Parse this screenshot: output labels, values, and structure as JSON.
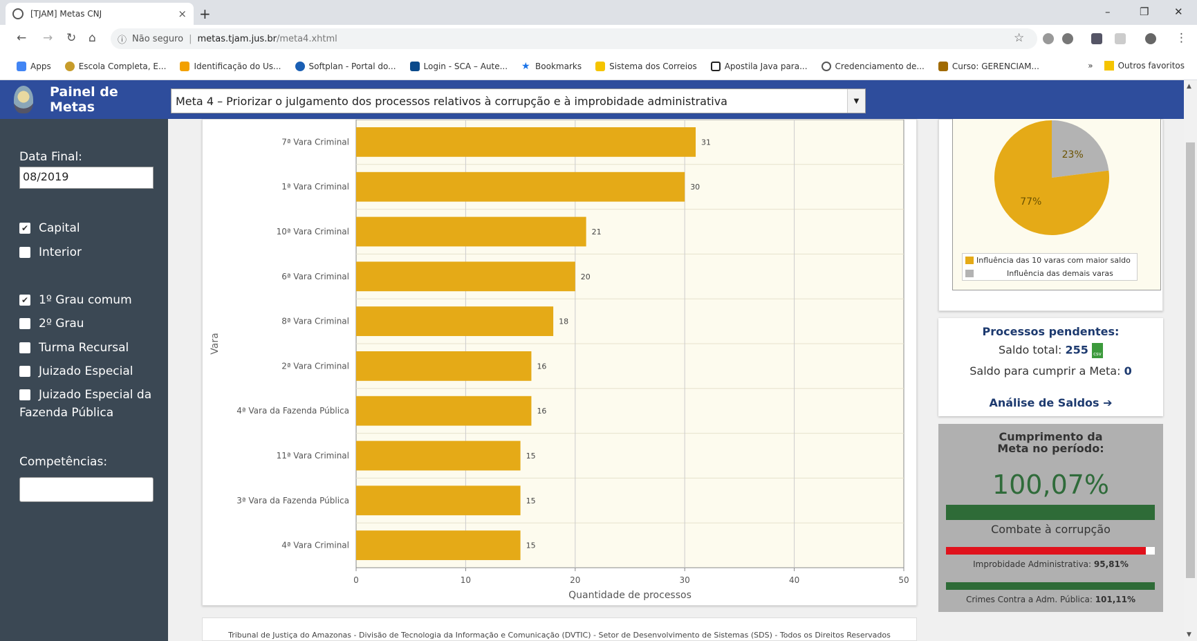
{
  "browser": {
    "tab_title": "[TJAM] Metas CNJ",
    "tab_close": "×",
    "new_tab": "+",
    "security_label": "Não seguro",
    "url_host": "metas.tjam.jus.br",
    "url_path": "/meta4.xhtml",
    "bookmarks": [
      "Apps",
      "Escola Completa, E...",
      "Identificação do Us...",
      "Softplan - Portal do...",
      "Login - SCA – Aute...",
      "Bookmarks",
      "Sistema dos Correios",
      "Apostila Java para...",
      "Credenciamento de...",
      "Curso: GERENCIAM..."
    ],
    "bookmarks_more": "»",
    "other_bookmarks": "Outros favoritos"
  },
  "header": {
    "title": "Painel de Metas",
    "selected_meta": "Meta 4 – Priorizar o julgamento dos processos relativos à corrupção e à improbidade administrativa"
  },
  "sidebar": {
    "date_label": "Data Final:",
    "date_value": "08/2019",
    "filters_location": [
      {
        "label": "Capital",
        "checked": true
      },
      {
        "label": "Interior",
        "checked": false
      }
    ],
    "filters_grau": [
      {
        "label": "1º Grau comum",
        "checked": true
      },
      {
        "label": "2º Grau",
        "checked": false
      },
      {
        "label": "Turma Recursal",
        "checked": false
      },
      {
        "label": "Juizado Especial",
        "checked": false
      },
      {
        "label": "Juizado Especial da Fazenda Pública",
        "checked": false
      }
    ],
    "competencias_label": "Competências:"
  },
  "chart_data": [
    {
      "type": "bar",
      "orientation": "horizontal",
      "categories": [
        "7ª Vara Criminal",
        "1ª Vara Criminal",
        "10ª Vara Criminal",
        "6ª Vara Criminal",
        "8ª Vara Criminal",
        "2ª Vara Criminal",
        "4ª Vara da Fazenda Pública",
        "11ª Vara Criminal",
        "3ª Vara da Fazenda Pública",
        "4ª Vara Criminal"
      ],
      "values": [
        31,
        30,
        21,
        20,
        18,
        16,
        16,
        15,
        15,
        15
      ],
      "xlabel": "Quantidade de processos",
      "ylabel": "Vara",
      "xlim": [
        0,
        50
      ],
      "xticks": [
        0,
        10,
        20,
        30,
        40,
        50
      ],
      "bar_color": "#e5aa17",
      "background": "#fdfbee",
      "grid": true
    },
    {
      "type": "pie",
      "slices": [
        {
          "label": "Influência das 10 varas com maior saldo",
          "value": 77,
          "text": "77%",
          "color": "#e5aa17"
        },
        {
          "label": "Influência das demais varas",
          "value": 23,
          "text": "23%",
          "color": "#b3b3b3"
        }
      ]
    }
  ],
  "pendentes": {
    "title": "Processos pendentes:",
    "saldo_total_label": "Saldo total:",
    "saldo_total_value": "255",
    "csv_icon_text": "csv",
    "saldo_meta_label": "Saldo para cumprir a Meta:",
    "saldo_meta_value": "0",
    "analise_link": "Análise de Saldos",
    "analise_arrow": "➔"
  },
  "cumprimento": {
    "title_line1": "Cumprimento da",
    "title_line2": "Meta no período:",
    "percent": "100,07%",
    "combate_label": "Combate à corrupção",
    "combate_fill": 1.0,
    "improbidade_label": "Improbidade Administrativa:",
    "improbidade_value": "95,81%",
    "improbidade_fill": 0.9581,
    "crimes_label": "Crimes Contra a Adm. Pública:",
    "crimes_value": "101,11%",
    "crimes_fill": 1.0,
    "colors": {
      "ok": "#2e6b37",
      "bad": "#e0121c"
    }
  },
  "footer": {
    "text": "Tribunal de Justiça do Amazonas - Divisão de Tecnologia da Informação e Comunicação (DVTIC) - Setor de Desenvolvimento de Sistemas (SDS) - Todos os Direitos Reservados"
  }
}
